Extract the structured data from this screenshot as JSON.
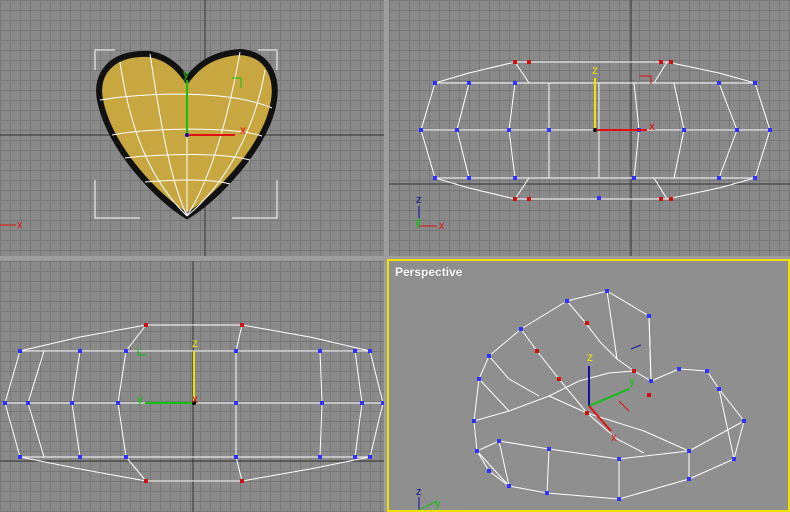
{
  "viewports": {
    "top": {
      "label": ""
    },
    "front": {
      "label": ""
    },
    "left": {
      "label": ""
    },
    "perspective": {
      "label": "Perspective"
    }
  },
  "gizmo": {
    "x_label": "x",
    "y_label": "y",
    "z_label": "z"
  },
  "colors": {
    "viewport_bg": "#8a8a8a",
    "grid_line": "#777777",
    "active_border": "#f0e000",
    "wire": "#ffffff",
    "vertex": "#3030ff",
    "selected_vertex": "#d01010",
    "heart_fill": "#c8a640",
    "axis_x": "#e01010",
    "axis_y": "#10c010",
    "axis_z": "#f0e000"
  }
}
